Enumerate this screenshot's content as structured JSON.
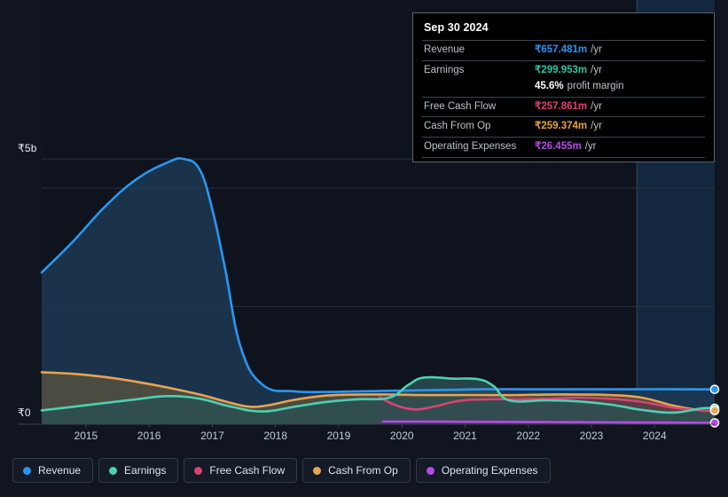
{
  "tooltip": {
    "date": "Sep 30 2024",
    "rows": [
      {
        "label": "Revenue",
        "value": "₹657.481m",
        "unit": "/yr",
        "color": "#2b96f1"
      },
      {
        "label": "Earnings",
        "value": "₹299.953m",
        "unit": "/yr",
        "color": "#2ec4a0"
      },
      {
        "label": "Free Cash Flow",
        "value": "₹257.861m",
        "unit": "/yr",
        "color": "#e0417a"
      },
      {
        "label": "Cash From Op",
        "value": "₹259.374m",
        "unit": "/yr",
        "color": "#e5a33f"
      },
      {
        "label": "Operating Expenses",
        "value": "₹26.455m",
        "unit": "/yr",
        "color": "#b84ae8"
      }
    ],
    "margin": {
      "value": "45.6%",
      "text": "profit margin"
    }
  },
  "legend": [
    {
      "label": "Revenue",
      "color": "#2b96f1"
    },
    {
      "label": "Earnings",
      "color": "#4dd0b1"
    },
    {
      "label": "Free Cash Flow",
      "color": "#d6456f"
    },
    {
      "label": "Cash From Op",
      "color": "#e8a354"
    },
    {
      "label": "Operating Expenses",
      "color": "#b84ae8"
    }
  ],
  "axis": {
    "y_top_label": "₹5b",
    "y_zero_label": "₹0",
    "x_labels": [
      "2015",
      "2016",
      "2017",
      "2018",
      "2019",
      "2020",
      "2021",
      "2022",
      "2023",
      "2024"
    ]
  },
  "chart_data": {
    "type": "area",
    "title": "",
    "xlabel": "",
    "ylabel": "",
    "currency": "INR",
    "units": "billions",
    "xlim": [
      2014.3,
      2024.95
    ],
    "ylim": [
      0,
      5.12
    ],
    "grid": true,
    "legend_position": "bottom",
    "gridlines_y": [
      5.0,
      4.45,
      2.22,
      0
    ],
    "x_tick_values": [
      2015,
      2016,
      2017,
      2018,
      2019,
      2020,
      2021,
      2022,
      2023,
      2024
    ],
    "highlight_band": {
      "from": 2023.72,
      "to": 2024.95
    },
    "series": [
      {
        "name": "Revenue",
        "color": "#2b96f1",
        "fill": "#1d3a56",
        "x": [
          2014.3,
          2014.8,
          2015.3,
          2015.8,
          2016.3,
          2016.55,
          2016.8,
          2017.0,
          2017.2,
          2017.45,
          2017.8,
          2018.3,
          2018.8,
          2019.3,
          2019.8,
          2020.3,
          2020.8,
          2021.3,
          2021.8,
          2022.3,
          2022.8,
          2023.3,
          2023.8,
          2024.3,
          2024.75,
          2024.95
        ],
        "y": [
          2.86,
          3.45,
          4.1,
          4.62,
          4.94,
          5.0,
          4.8,
          4.05,
          2.95,
          1.45,
          0.74,
          0.62,
          0.61,
          0.62,
          0.63,
          0.64,
          0.65,
          0.66,
          0.66,
          0.66,
          0.66,
          0.66,
          0.66,
          0.66,
          0.657,
          0.657
        ]
      },
      {
        "name": "Earnings",
        "color": "#4dd0b1",
        "fill": "#2c4f53",
        "x": [
          2014.3,
          2014.8,
          2015.3,
          2015.8,
          2016.3,
          2016.8,
          2017.3,
          2017.8,
          2018.3,
          2018.8,
          2019.3,
          2019.8,
          2020.1,
          2020.35,
          2020.8,
          2021.2,
          2021.45,
          2021.7,
          2022.3,
          2022.8,
          2023.3,
          2023.8,
          2024.3,
          2024.75,
          2024.95
        ],
        "y": [
          0.26,
          0.33,
          0.4,
          0.47,
          0.53,
          0.48,
          0.33,
          0.24,
          0.33,
          0.42,
          0.47,
          0.5,
          0.74,
          0.88,
          0.86,
          0.85,
          0.72,
          0.45,
          0.45,
          0.43,
          0.37,
          0.27,
          0.22,
          0.3,
          0.3
        ]
      },
      {
        "name": "Free Cash Flow",
        "color": "#d6456f",
        "fill": "#5a3a48",
        "x": [
          2019.65,
          2019.9,
          2020.2,
          2020.5,
          2020.9,
          2021.3,
          2021.8,
          2022.3,
          2022.8,
          2023.3,
          2023.8,
          2024.3,
          2024.75,
          2024.95
        ],
        "y": [
          0.51,
          0.36,
          0.28,
          0.33,
          0.44,
          0.47,
          0.47,
          0.48,
          0.5,
          0.48,
          0.42,
          0.31,
          0.258,
          0.258
        ]
      },
      {
        "name": "Cash From Op",
        "color": "#e8a354",
        "fill": "#55523f",
        "x": [
          2014.3,
          2014.8,
          2015.3,
          2015.8,
          2016.3,
          2016.8,
          2017.3,
          2017.6,
          2017.9,
          2018.3,
          2018.8,
          2019.3,
          2019.8,
          2020.3,
          2020.8,
          2021.3,
          2021.8,
          2022.3,
          2022.8,
          2023.3,
          2023.8,
          2024.3,
          2024.75,
          2024.95
        ],
        "y": [
          0.98,
          0.95,
          0.89,
          0.8,
          0.69,
          0.56,
          0.4,
          0.33,
          0.36,
          0.46,
          0.54,
          0.56,
          0.56,
          0.55,
          0.55,
          0.55,
          0.55,
          0.56,
          0.56,
          0.55,
          0.5,
          0.35,
          0.259,
          0.259
        ]
      },
      {
        "name": "Operating Expenses",
        "color": "#b84ae8",
        "fill": "#3d2a50",
        "x": [
          2019.7,
          2020.3,
          2021.3,
          2022.3,
          2023.3,
          2024.3,
          2024.75,
          2024.95
        ],
        "y": [
          0.05,
          0.05,
          0.045,
          0.04,
          0.035,
          0.03,
          0.0265,
          0.0265
        ]
      }
    ]
  }
}
